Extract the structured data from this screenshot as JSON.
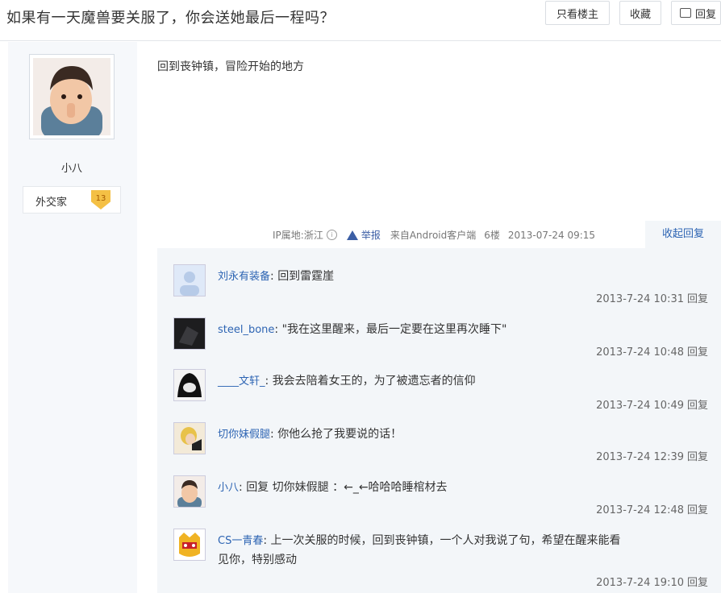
{
  "thread": {
    "title": "如果有一天魔兽要关服了，你会送她最后一程吗？"
  },
  "toolbar": {
    "only_op": "只看楼主",
    "favorite": "收藏",
    "reply": "回复"
  },
  "post": {
    "author": "小八",
    "badge_text": "外交家",
    "badge_level": "13",
    "content": "回到丧钟镇，冒险开始的地方",
    "meta": {
      "ip": "IP属地:浙江",
      "report": "举报",
      "source": "来自Android客户端",
      "floor": "6楼",
      "time": "2013-07-24 09:15"
    },
    "collapse_replies": "收起回复"
  },
  "replies": [
    {
      "user": "刘永有装备",
      "sep": ": ",
      "text": "回到雷霆崖",
      "text2": "",
      "time": "2013-7-24 10:31",
      "reply_label": "回复"
    },
    {
      "user": "steel_bone",
      "sep": ": ",
      "text": "\"我在这里醒来，最后一定要在这里再次睡下\"",
      "text2": "",
      "time": "2013-7-24 10:48",
      "reply_label": "回复"
    },
    {
      "user": "____文轩_",
      "sep": ": ",
      "text": "我会去陪着女王的，为了被遗忘者的信仰",
      "text2": "",
      "time": "2013-7-24 10:49",
      "reply_label": "回复"
    },
    {
      "user": "切你妹假腿",
      "sep": ": ",
      "text": "你他么抢了我要说的话！",
      "text2": "",
      "time": "2013-7-24 12:39",
      "reply_label": "回复"
    },
    {
      "user": "小八",
      "sep": ": ",
      "text": "回复 切你妹假腿 ：←_←哈哈哈睡棺材去",
      "text2": "",
      "time": "2013-7-24 12:48",
      "reply_label": "回复"
    },
    {
      "user": "CS一青春",
      "sep": ": ",
      "text": "上一次关服的时候，回到丧钟镇，一个人对我说了句，希望在醒来能看",
      "text2": "见你，特别感动",
      "time": "2013-7-24 19:10",
      "reply_label": "回复"
    }
  ]
}
